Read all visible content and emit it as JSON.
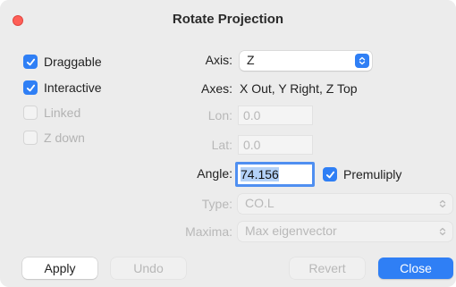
{
  "window": {
    "title": "Rotate Projection"
  },
  "options": {
    "draggable": {
      "label": "Draggable",
      "checked": true
    },
    "interactive": {
      "label": "Interactive",
      "checked": true
    },
    "linked": {
      "label": "Linked",
      "checked": false
    },
    "z_down": {
      "label": "Z down",
      "checked": false
    }
  },
  "axis": {
    "label": "Axis:",
    "value": "Z"
  },
  "axes": {
    "label": "Axes:",
    "value": "X Out, Y Right, Z Top"
  },
  "lon": {
    "label": "Lon:",
    "value": "0.0"
  },
  "lat": {
    "label": "Lat:",
    "value": "0.0"
  },
  "angle": {
    "label": "Angle:",
    "value": "74.156"
  },
  "premultiply": {
    "label": "Premuliply",
    "checked": true
  },
  "type": {
    "label": "Type:",
    "value": "CO.L"
  },
  "maxima": {
    "label": "Maxima:",
    "value": "Max eigenvector"
  },
  "buttons": {
    "apply": "Apply",
    "undo": "Undo",
    "revert": "Revert",
    "close": "Close"
  },
  "colors": {
    "accent": "#2f7ff5",
    "close_dot": "#fe5f57"
  }
}
